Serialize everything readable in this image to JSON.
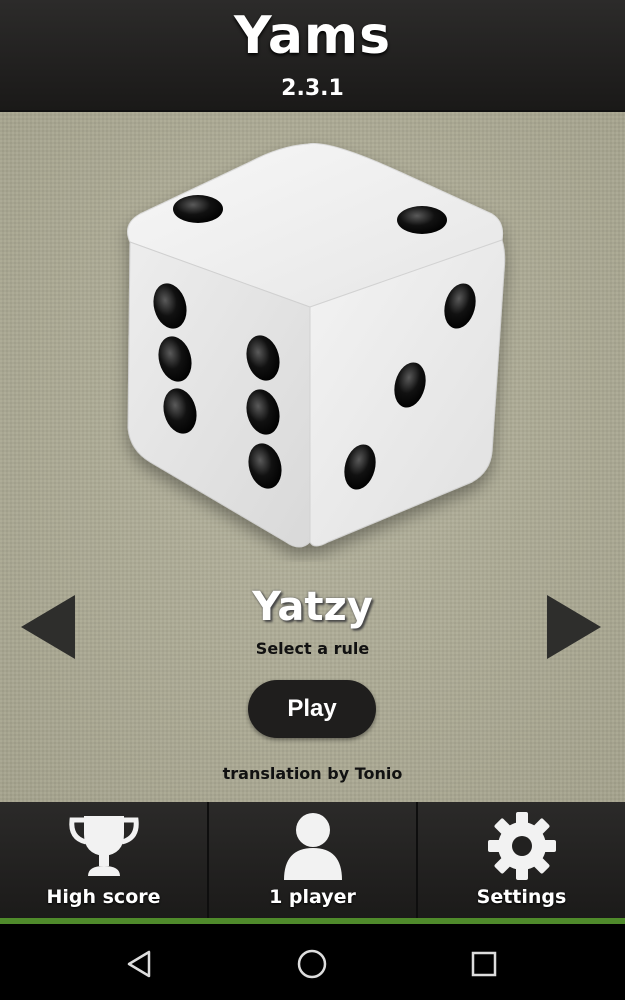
{
  "header": {
    "title": "Yams",
    "version": "2.3.1"
  },
  "main": {
    "rule_name": "Yatzy",
    "rule_hint": "Select a rule",
    "play_label": "Play",
    "credit": "translation by Tonio"
  },
  "bottom_tabs": [
    {
      "label": "High score",
      "icon": "trophy-icon"
    },
    {
      "label": "1 player",
      "icon": "person-icon"
    },
    {
      "label": "Settings",
      "icon": "gear-icon"
    }
  ],
  "nav": {
    "back": "back-icon",
    "home": "home-icon",
    "recents": "recents-icon"
  },
  "colors": {
    "accent": "#4f8a2b",
    "background": "#a9a791",
    "bar": "#222120"
  }
}
